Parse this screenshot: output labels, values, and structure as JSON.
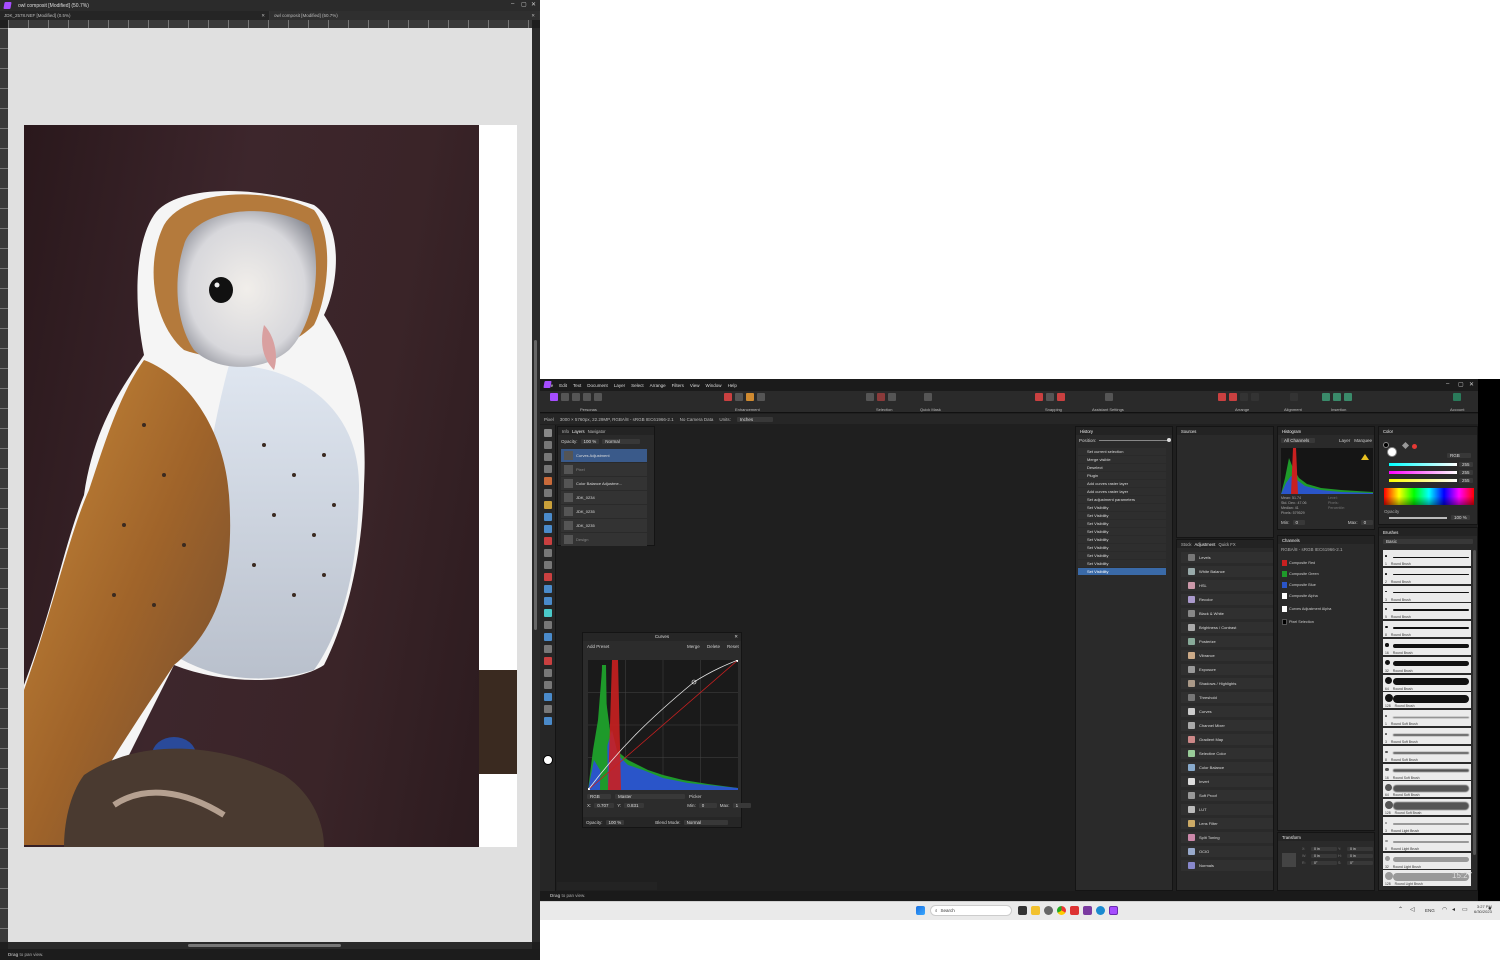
{
  "left_window": {
    "title": "owl composit [Modified] (50.7%)",
    "tabs": [
      "JDK_2578.NEF [Modified] (0.5%)",
      "owl composit [Modified] (50.7%)"
    ],
    "status": {
      "bold": "Drag",
      "rest": " to pan view."
    }
  },
  "right_window": {
    "menu": [
      "File",
      "Edit",
      "Text",
      "Document",
      "Layer",
      "Select",
      "Arrange",
      "Filters",
      "View",
      "Window",
      "Help"
    ],
    "toolbar_labels": [
      "Personas",
      "Enhancement",
      "Selection",
      "Quick Mask",
      "Snapping",
      "Assistant Settings",
      "Arrange",
      "Alignment",
      "Insertion",
      "Account"
    ],
    "context": {
      "pixel_label": "Pixel",
      "info": "3000 × 5760px, 22.29MP, RGBA/8 - sRGB IEC61966-2.1",
      "camera": "No Camera Data",
      "units_label": "Units:",
      "units_value": "Inches"
    },
    "layers": {
      "tabs": [
        "Info",
        "Layers",
        "Navigator"
      ],
      "opacity_label": "Opacity:",
      "opacity_value": "100 %",
      "blend": "Normal",
      "rows": [
        "Curves Adjustment",
        "Pixel",
        "Color Balance Adjustme...",
        "JDK_0234",
        "JDK_0235",
        "JDK_0235",
        "Design"
      ]
    },
    "curves": {
      "title": "Curves",
      "add_preset": "Add Preset",
      "merge": "Merge",
      "delete": "Delete",
      "reset": "Reset",
      "channel": "RGB",
      "mode": "Master",
      "picker": "Picker",
      "x_label": "X:",
      "x_value": "0.707",
      "y_label": "Y:",
      "y_value": "0.831",
      "min_label": "Min:",
      "min_value": "0",
      "max_label": "Max:",
      "max_value": "1",
      "opacity_label": "Opacity:",
      "opacity_value": "100 %",
      "blend_label": "Blend Mode:",
      "blend_value": "Normal"
    },
    "history": {
      "title": "History",
      "position_label": "Position:",
      "items": [
        "Set current selection",
        "Merge visible",
        "Deselect",
        "Plugin",
        "Add curves raster layer",
        "Add curves raster layer",
        "Set adjustment parameters",
        "Set Visibility",
        "Set Visibility",
        "Set Visibility",
        "Set Visibility",
        "Set Visibility",
        "Set Visibility",
        "Set Visibility",
        "Set Visibility",
        "Set Visibility"
      ]
    },
    "sources": {
      "title": "Sources"
    },
    "adjustments": {
      "tabs": [
        "Stock",
        "Adjustment",
        "Quick FX"
      ],
      "items": [
        "Levels",
        "White Balance",
        "HSL",
        "Recolor",
        "Black & White",
        "Brightness / Contrast",
        "Posterize",
        "Vibrance",
        "Exposure",
        "Shadows / Highlights",
        "Threshold",
        "Curves",
        "Channel Mixer",
        "Gradient Map",
        "Selective Color",
        "Color Balance",
        "Invert",
        "Soft Proof",
        "LUT",
        "Lens Filter",
        "Split Toning",
        "OCIO",
        "Normals"
      ]
    },
    "histogram": {
      "title": "Histogram",
      "channel": "All Channels",
      "layer": "Layer",
      "marquee": "Marquee",
      "stats_left": [
        "Mean: 51.74",
        "Std. Dev.: 47.06",
        "Median: 41",
        "Pixels: 579529"
      ],
      "stats_right": [
        "Level:",
        "Pixels:",
        "Percentile:"
      ],
      "min_label": "Min:",
      "min_value": "0",
      "max_label": "Max:",
      "max_value": "0"
    },
    "channels": {
      "title": "Channels",
      "profile": "RGBA/8 - sRGB IEC61966-2.1",
      "items": [
        "Composite Red",
        "Composite Green",
        "Composite Blue",
        "Composite Alpha",
        "Curves Adjustment Alpha",
        "Pixel Selection"
      ]
    },
    "transform": {
      "title": "Transform",
      "fields": [
        "X:",
        "Y:",
        "W:",
        "H:",
        "R:",
        "S:"
      ],
      "values": [
        "0 in",
        "0 in",
        "0 in",
        "0 in",
        "0°",
        "0°"
      ]
    },
    "color": {
      "title": "Color",
      "model": "RGB",
      "values": [
        "255",
        "255",
        "255"
      ],
      "opacity_label": "Opacity",
      "opacity_value": "100 %",
      "accent": "#e53935"
    },
    "brushes": {
      "title": "Brushes",
      "category": "Basic",
      "items": [
        {
          "size": "1",
          "name": "Round Brush"
        },
        {
          "size": "2",
          "name": "Round Brush"
        },
        {
          "size": "3",
          "name": "Round Brush"
        },
        {
          "size": "5",
          "name": "Round Brush"
        },
        {
          "size": "8",
          "name": "Round Brush"
        },
        {
          "size": "16",
          "name": "Round Brush"
        },
        {
          "size": "32",
          "name": "Round Brush"
        },
        {
          "size": "64",
          "name": "Round Brush"
        },
        {
          "size": "128",
          "name": "Round Brush"
        },
        {
          "size": "1",
          "name": "Round Soft Brush"
        },
        {
          "size": "3",
          "name": "Round Soft Brush"
        },
        {
          "size": "8",
          "name": "Round Soft Brush"
        },
        {
          "size": "16",
          "name": "Round Soft Brush"
        },
        {
          "size": "64",
          "name": "Round Soft Brush"
        },
        {
          "size": "128",
          "name": "Round Soft Brush"
        },
        {
          "size": "3",
          "name": "Round Light Brush"
        },
        {
          "size": "8",
          "name": "Round Light Brush"
        },
        {
          "size": "32",
          "name": "Round Light Brush"
        },
        {
          "size": "128",
          "name": "Round Light Brush"
        }
      ]
    },
    "status": {
      "bold": "Drag",
      "rest": " to pan view."
    },
    "overlay_time": "15:27"
  },
  "taskbar": {
    "search": "Search",
    "lang": "ENG",
    "time": "3:27 PM",
    "date": "6/30/2023"
  }
}
